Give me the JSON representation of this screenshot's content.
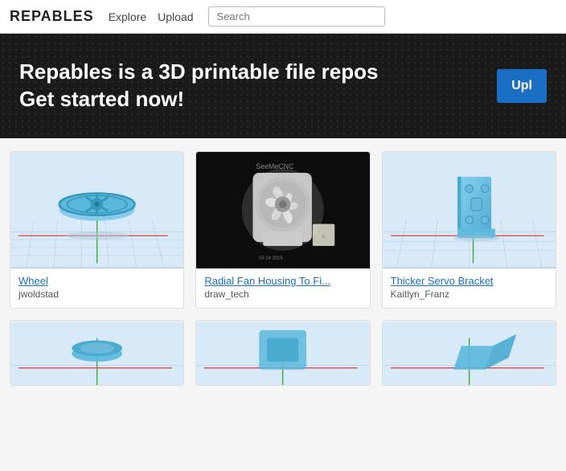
{
  "topbar": {
    "logo": "REPABLES",
    "nav": [
      {
        "label": "Explore"
      },
      {
        "label": "Upload"
      }
    ],
    "search_placeholder": "Search"
  },
  "hero": {
    "title_line1": "Repables is a 3D printable file repos",
    "title_line2": "Get started now!",
    "cta_label": "Upl"
  },
  "cards_row1": [
    {
      "title": "Wheel",
      "author": "jwoldstad",
      "thumb_type": "wheel"
    },
    {
      "title": "Radial Fan Housing To Fi...",
      "author": "draw_tech",
      "thumb_type": "fan"
    },
    {
      "title": "Thicker Servo Bracket",
      "author": "Kaitlyn_Franz",
      "thumb_type": "servo"
    }
  ],
  "cards_row2": [
    {
      "title": "",
      "author": "",
      "thumb_type": "partial-blue"
    },
    {
      "title": "",
      "author": "",
      "thumb_type": "partial-blue2"
    },
    {
      "title": "",
      "author": "",
      "thumb_type": "partial-blue3"
    }
  ]
}
